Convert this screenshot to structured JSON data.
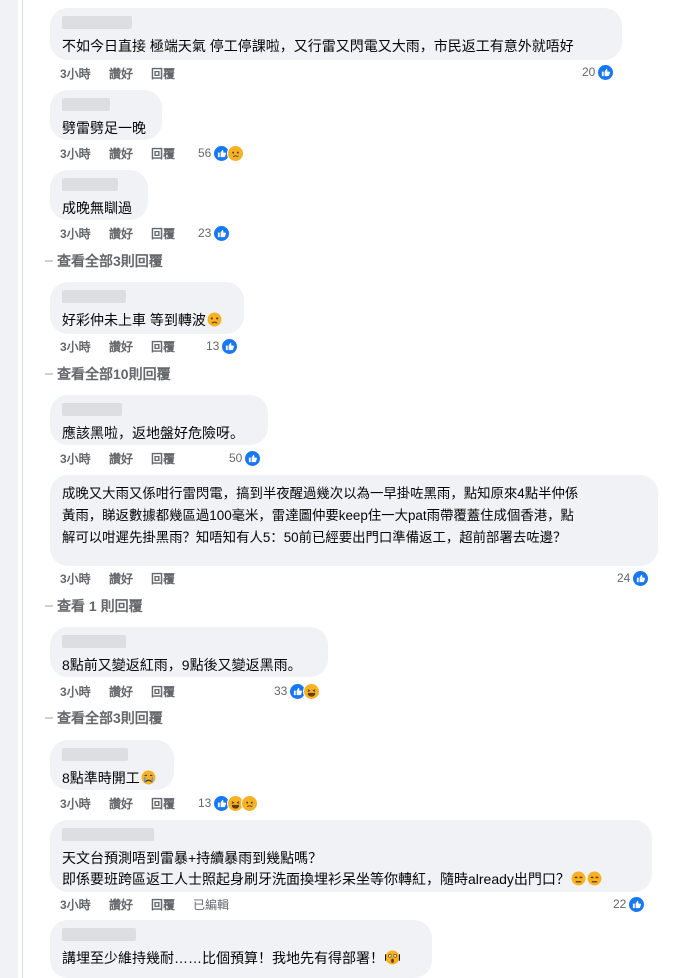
{
  "comments": [
    {
      "text": "不如今日直接 極端天氣 停工停課啦，又行雷又閃電又大雨，市民返工有意外就唔好",
      "time": "3小時",
      "like": "讚好",
      "reply": "回覆",
      "count": "20",
      "reactions": [
        "like-icon"
      ]
    },
    {
      "text": "劈雷劈足一晚",
      "time": "3小時",
      "like": "讚好",
      "reply": "回覆",
      "count": "56",
      "reactions": [
        "like-icon",
        "sad-icon"
      ]
    },
    {
      "text": "成晚無瞓過",
      "time": "3小時",
      "like": "讚好",
      "reply": "回覆",
      "count": "23",
      "reactions": [
        "like-icon"
      ]
    },
    {
      "text": "好彩仲未上車 等到轉波",
      "time": "3小時",
      "like": "讚好",
      "reply": "回覆",
      "count": "13",
      "reactions": [
        "like-icon"
      ]
    },
    {
      "text": "應該黑啦，返地盤好危險呀。",
      "time": "3小時",
      "like": "讚好",
      "reply": "回覆",
      "count": "50",
      "reactions": [
        "like-icon"
      ]
    },
    {
      "text": "成晚又大雨又係咁行雷閃電，搞到半夜醒過幾次以為一早掛咗黑雨，點知原來4點半仲係\n黃雨，睇返數據都幾區過100毫米，雷達圖仲要keep住一大pat雨帶覆蓋住成個香港，點\n解可以咁遲先掛黑雨？知唔知有人5：50前已經要出門口準備返工，超前部署去咗邊？",
      "time": "3小時",
      "like": "讚好",
      "reply": "回覆",
      "count": "24",
      "reactions": [
        "like-icon"
      ]
    },
    {
      "text": "8點前又變返紅雨，9點後又變返黑雨。",
      "time": "3小時",
      "like": "讚好",
      "reply": "回覆",
      "count": "33",
      "reactions": [
        "like-icon",
        "haha-icon"
      ]
    },
    {
      "text": "8點準時開工",
      "time": "3小時",
      "like": "讚好",
      "reply": "回覆",
      "count": "13",
      "reactions": [
        "like-icon",
        "haha-icon",
        "sad-icon"
      ]
    },
    {
      "text": "天文台預測唔到雷暴+持續暴雨到幾點嗎？\n即係要班跨區返工人士照起身刷牙洗面換埋衫呆坐等你轉紅，隨時already出門口？",
      "time": "3小時",
      "like": "讚好",
      "reply": "回覆",
      "edited": "已編輯",
      "count": "22",
      "reactions": [
        "like-icon"
      ]
    },
    {
      "text": "講埋至少維持幾耐……比個預算！我地先有得部署！",
      "time": "",
      "like": "",
      "reply": "",
      "count": "",
      "reactions": []
    }
  ],
  "view_replies": [
    {
      "label": "查看全部3則回覆"
    },
    {
      "label": "查看全部10則回覆"
    },
    {
      "label": "查看 1 則回覆"
    },
    {
      "label": "查看全部3則回覆"
    }
  ],
  "colors": {
    "like": "#1877f2",
    "emoji": "#f7b125",
    "bubble": "#f0f2f5",
    "meta": "#65676b"
  }
}
